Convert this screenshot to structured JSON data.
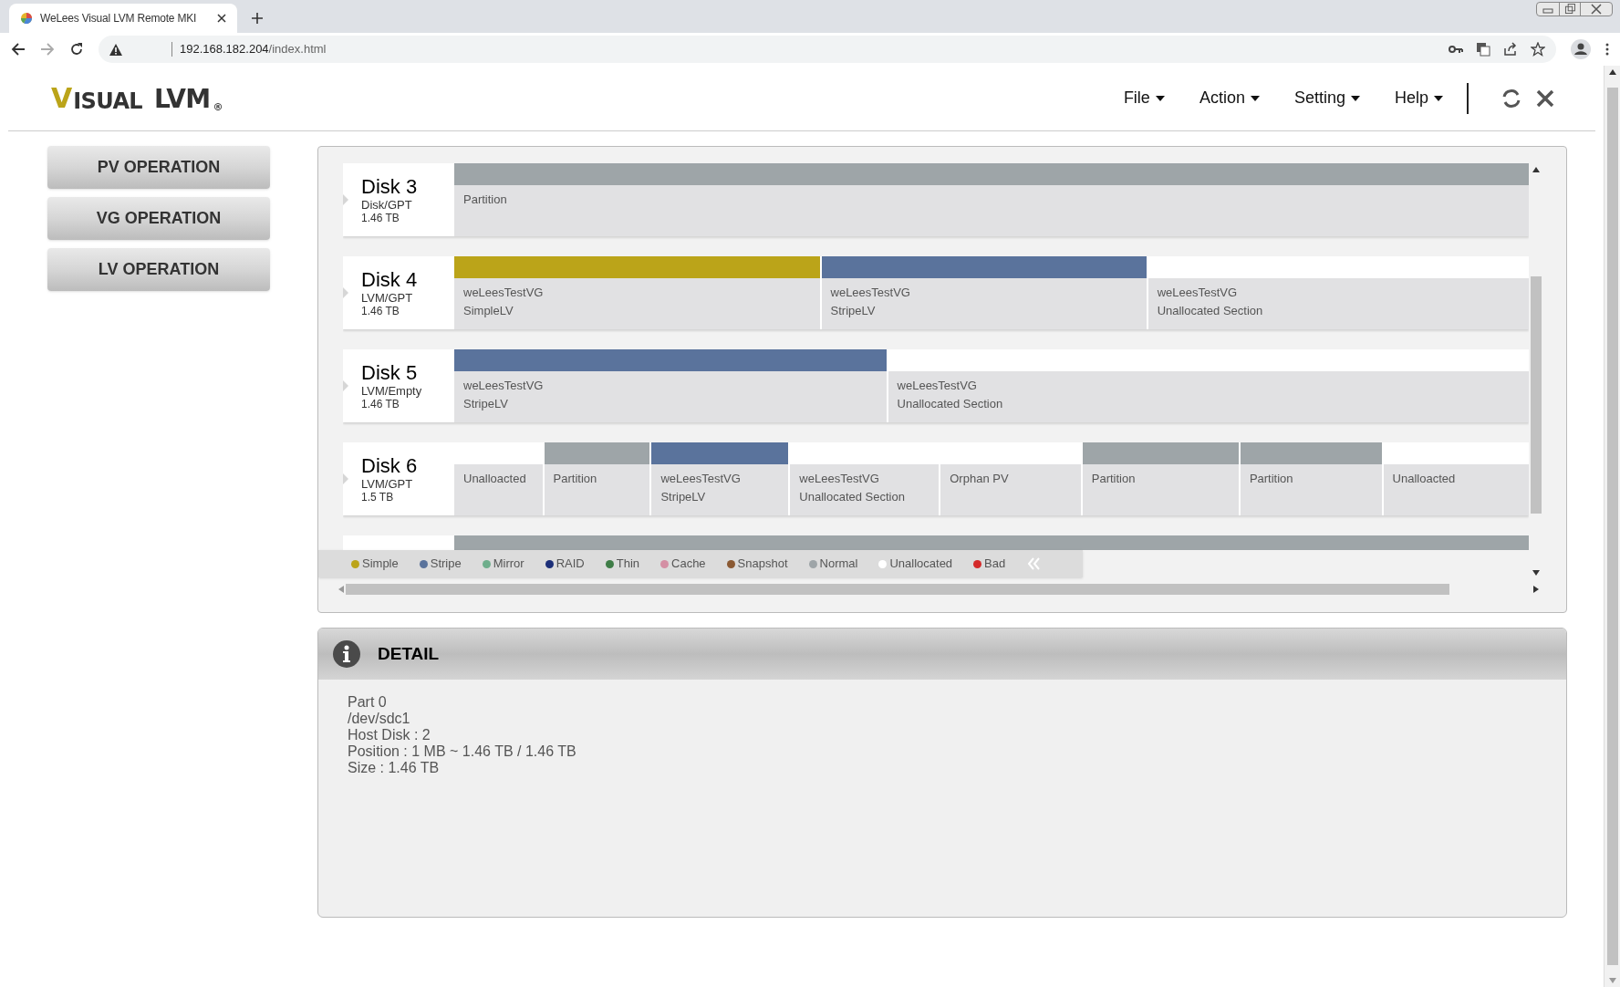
{
  "browser": {
    "tab_title": "WeLees Visual LVM Remote MKI",
    "url_host": "192.168.182.204",
    "url_path": "/index.html"
  },
  "logo": {
    "parts": [
      "V",
      "ISUAL",
      "LVM"
    ],
    "mark": "®"
  },
  "menu": [
    {
      "label": "File"
    },
    {
      "label": "Action"
    },
    {
      "label": "Setting"
    },
    {
      "label": "Help"
    }
  ],
  "sidebar": {
    "buttons": [
      "PV OPERATION",
      "VG OPERATION",
      "LV OPERATION"
    ]
  },
  "disks": [
    {
      "name": "Disk 3",
      "type": "Disk/GPT",
      "size": "1.46 TB",
      "segments": [
        {
          "kind": "normal",
          "lines": [
            "Partition"
          ]
        }
      ]
    },
    {
      "name": "Disk 4",
      "type": "LVM/GPT",
      "size": "1.46 TB",
      "segments": [
        {
          "kind": "simple",
          "lines": [
            "weLeesTestVG",
            "SimpleLV"
          ]
        },
        {
          "kind": "stripe",
          "lines": [
            "weLeesTestVG",
            "StripeLV"
          ]
        },
        {
          "kind": "unallocated",
          "lines": [
            "weLeesTestVG",
            "Unallocated Section"
          ]
        }
      ]
    },
    {
      "name": "Disk 5",
      "type": "LVM/Empty",
      "size": "1.46 TB",
      "segments": [
        {
          "kind": "stripe",
          "lines": [
            "weLeesTestVG",
            "StripeLV"
          ]
        },
        {
          "kind": "unallocated",
          "lines": [
            "weLeesTestVG",
            "Unallocated Section"
          ]
        }
      ]
    },
    {
      "name": "Disk 6",
      "type": "LVM/GPT",
      "size": "1.5 TB",
      "segments": [
        {
          "kind": "unallocated",
          "lines": [
            "Unalloacted"
          ]
        },
        {
          "kind": "normal",
          "lines": [
            "Partition"
          ]
        },
        {
          "kind": "stripe",
          "lines": [
            "weLeesTestVG",
            "StripeLV"
          ]
        },
        {
          "kind": "unallocated",
          "lines": [
            "weLeesTestVG",
            "Unallocated Section"
          ]
        },
        {
          "kind": "unallocated",
          "lines": [
            "Orphan PV"
          ]
        },
        {
          "kind": "normal",
          "lines": [
            "Partition"
          ]
        },
        {
          "kind": "normal",
          "lines": [
            "Partition"
          ]
        },
        {
          "kind": "unallocated",
          "lines": [
            "Unalloacted"
          ]
        }
      ]
    },
    {
      "segments": [
        {
          "kind": "normal"
        }
      ]
    }
  ],
  "legend": [
    {
      "label": "Simple",
      "color": "#bba419"
    },
    {
      "label": "Stripe",
      "color": "#5a739c"
    },
    {
      "label": "Mirror",
      "color": "#6fae8c"
    },
    {
      "label": "RAID",
      "color": "#1c2f78"
    },
    {
      "label": "Thin",
      "color": "#3f7d47"
    },
    {
      "label": "Cache",
      "color": "#d48fa4"
    },
    {
      "label": "Snapshot",
      "color": "#8b5a33"
    },
    {
      "label": "Normal",
      "color": "#9ea5a8"
    },
    {
      "label": "Unallocated",
      "color": "#ffffff"
    },
    {
      "label": "Bad",
      "color": "#d42a2a"
    }
  ],
  "detail": {
    "title": "DETAIL",
    "lines": [
      "Part 0",
      "/dev/sdc1",
      "Host Disk : 2",
      "Position : 1 MB ~ 1.46 TB / 1.46 TB",
      "Size : 1.46 TB"
    ]
  }
}
